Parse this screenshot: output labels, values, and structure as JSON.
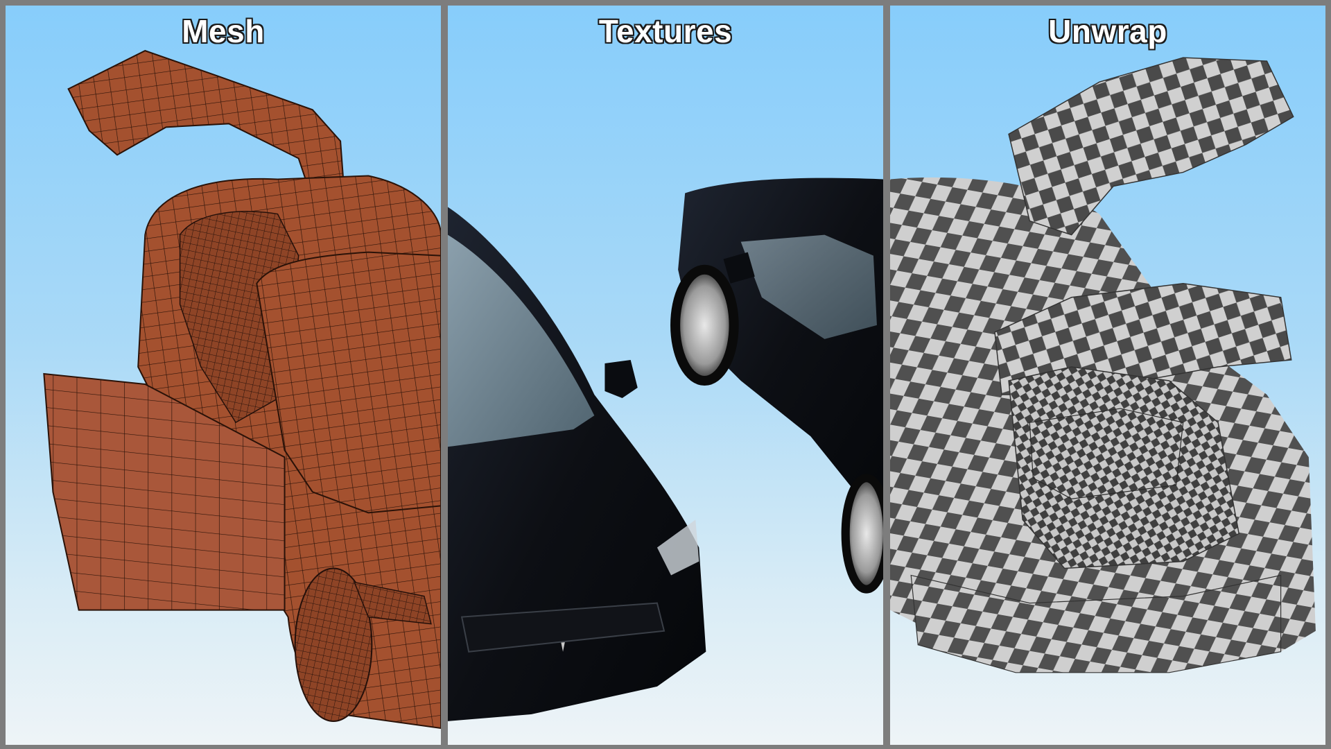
{
  "panels": [
    {
      "id": "mesh",
      "title": "Mesh",
      "fill_color": "#a4512f",
      "line_color": "#2a1208"
    },
    {
      "id": "textures",
      "title": "Textures",
      "paint_color": "#0d0f14",
      "glass_color": "#9fb6c3"
    },
    {
      "id": "unwrap",
      "title": "Unwrap",
      "checker_light": "#d0d0d0",
      "checker_dark": "#4a4a4a"
    }
  ],
  "colors": {
    "sky_top": "#87cdfb",
    "sky_bottom": "#eef4f7",
    "divider": "#7d7d7d"
  }
}
